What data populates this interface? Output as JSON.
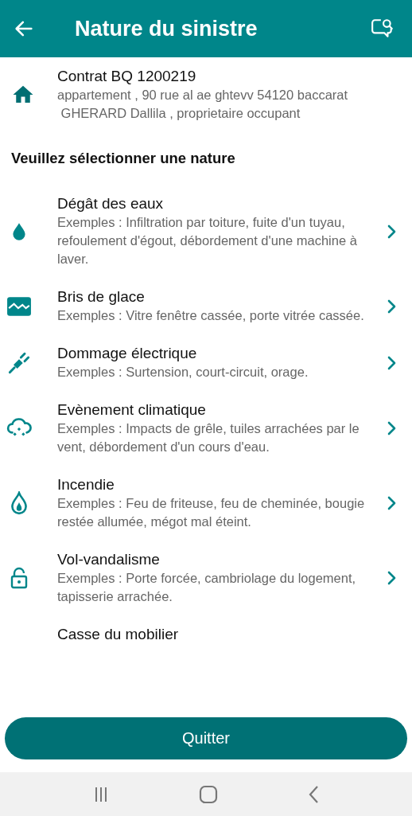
{
  "header": {
    "title": "Nature du sinistre"
  },
  "contract": {
    "title": "Contrat BQ 1200219",
    "address": "appartement , 90 rue al ae ghtevv 54120 baccarat",
    "holder": " GHERARD Dallila , proprietaire occupant"
  },
  "section_title": "Veuillez sélectionner une nature",
  "natures": [
    {
      "kind": "water",
      "title": "Dégât des eaux",
      "description": "Exemples : Infiltration par toiture, fuite d'un tuyau, refoulement d'égout, débordement d'une machine à laver."
    },
    {
      "kind": "glass",
      "title": "Bris de glace",
      "description": "Exemples : Vitre fenêtre cassée, porte vitrée cassée."
    },
    {
      "kind": "electric",
      "title": "Dommage électrique",
      "description": "Exemples : Surtension, court-circuit, orage."
    },
    {
      "kind": "weather",
      "title": "Evènement climatique",
      "description": "Exemples : Impacts de grêle, tuiles arrachées par le vent, débordement d'un cours d'eau."
    },
    {
      "kind": "fire",
      "title": "Incendie",
      "description": "Exemples : Feu de friteuse, feu de cheminée, bougie restée allumée, mégot mal éteint."
    },
    {
      "kind": "theft",
      "title": "Vol-vandalisme",
      "description": "Exemples : Porte forcée, cambriolage du logement, tapisserie arrachée."
    },
    {
      "title": "Casse du mobilier"
    }
  ],
  "quit_button": "Quitter"
}
